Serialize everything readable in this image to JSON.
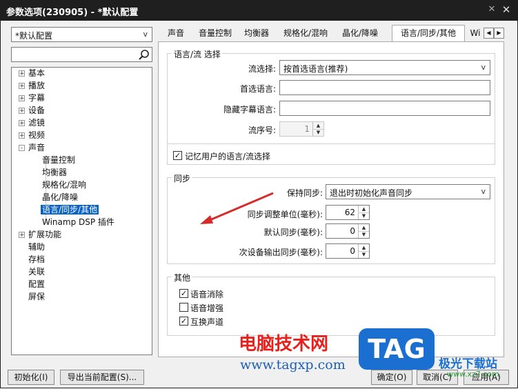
{
  "window": {
    "title": "参数选项(230905) - *默认配置",
    "pin_icon": "pin-icon",
    "close_icon": "close-icon"
  },
  "profile_select": {
    "value": "*默认配置"
  },
  "search": {
    "value": "",
    "icon": "search-icon"
  },
  "tree": {
    "items": [
      {
        "label": "基本",
        "expander": "+"
      },
      {
        "label": "播放",
        "expander": "+"
      },
      {
        "label": "字幕",
        "expander": "+"
      },
      {
        "label": "设备",
        "expander": "+"
      },
      {
        "label": "滤镜",
        "expander": "+"
      },
      {
        "label": "视频",
        "expander": "+"
      },
      {
        "label": "声音",
        "expander": "-"
      },
      {
        "label": "音量控制"
      },
      {
        "label": "均衡器"
      },
      {
        "label": "规格化/混响"
      },
      {
        "label": "晶化/降噪"
      },
      {
        "label": "语言/同步/其他"
      },
      {
        "label": "Winamp DSP 插件"
      },
      {
        "label": "扩展功能",
        "expander": "+"
      },
      {
        "label": "辅助"
      },
      {
        "label": "存档"
      },
      {
        "label": "关联"
      },
      {
        "label": "配置"
      },
      {
        "label": "屏保"
      }
    ]
  },
  "tabs": [
    "声音",
    "音量控制",
    "均衡器",
    "规格化/混响",
    "晶化/降噪",
    "语言/同步/其他",
    "Wi"
  ],
  "tab_scroll": {
    "left": "◀",
    "right": "▶"
  },
  "lang_group": {
    "title": "语言/流 选择",
    "stream_select_label": "流选择:",
    "stream_select_value": "按首选语言(推荐)",
    "preferred_lang_label": "首选语言:",
    "preferred_lang_value": "",
    "hidden_sub_label": "隐藏字幕语言:",
    "hidden_sub_value": "",
    "stream_no_label": "流序号:",
    "stream_no_value": "1",
    "remember_label": "记忆用户的语言/流选择",
    "remember_checked": "✓"
  },
  "sync_group": {
    "title": "同步",
    "keep_sync_label": "保持同步:",
    "keep_sync_value": "退出时初始化声音同步",
    "adjust_unit_label": "同步调整单位(毫秒):",
    "adjust_unit_value": "62",
    "default_sync_label": "默认同步(毫秒):",
    "default_sync_value": "0",
    "secondary_sync_label": "次设备输出同步(毫秒):",
    "secondary_sync_value": "0"
  },
  "other_group": {
    "title": "其他",
    "items": [
      {
        "label": "语音消除",
        "check": "✓"
      },
      {
        "label": "语音增强",
        "check": ""
      },
      {
        "label": "互换声道",
        "check": "✓"
      }
    ]
  },
  "footer": {
    "init_button": "初始化(I)",
    "export_button": "导出当前配置(S)...",
    "ok_button": "确定(O)",
    "cancel_button": "取消(C)",
    "apply_button": "应用(A)"
  },
  "watermark": {
    "cn_text": "电脑技术网",
    "url": "www.tagxp.com",
    "logo": "TAG",
    "site": "极光下载站",
    "site_url": "www.xz7.com"
  },
  "annotation": {
    "color": "#d42b2b"
  }
}
